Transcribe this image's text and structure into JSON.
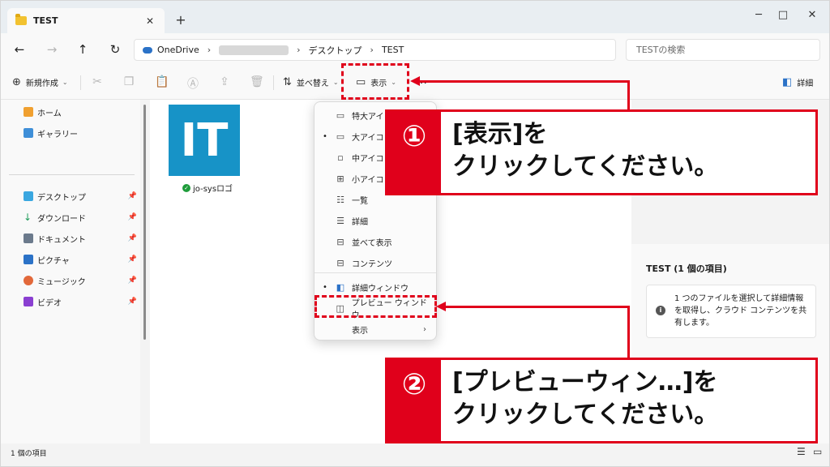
{
  "window": {
    "tab_title": "TEST",
    "tab_close": "✕",
    "tab_add": "+",
    "minimize": "─",
    "maximize": "□",
    "close": "✕"
  },
  "nav": {
    "back": "←",
    "forward": "→",
    "up": "↑",
    "refresh": "↻",
    "breadcrumb": [
      "OneDrive",
      "デスクトップ",
      "TEST"
    ],
    "crumb_sep": "›",
    "search_placeholder": "TESTの検索"
  },
  "toolbar": {
    "new_label": "新規作成",
    "sort_label": "並べ替え",
    "view_label": "表示",
    "more": "…",
    "details_label": "詳細"
  },
  "sidebar": {
    "home": "ホーム",
    "gallery": "ギャラリー",
    "pinned": [
      "デスクトップ",
      "ダウンロード",
      "ドキュメント",
      "ピクチャ",
      "ミュージック",
      "ビデオ"
    ],
    "pin_glyph": "📌"
  },
  "content": {
    "file_logo_text": "IT",
    "file_name": "jo-sysロゴ"
  },
  "details_pane": {
    "title": "TEST (1 個の項目)",
    "info_text": "1 つのファイルを選択して詳細情報を取得し、クラウド コンテンツを共有します。",
    "info_icon": "i"
  },
  "status": {
    "item_count": "1 個の項目"
  },
  "menu": {
    "items": [
      {
        "label": "特大アイコン",
        "bullet": ""
      },
      {
        "label": "大アイコン",
        "bullet": "•"
      },
      {
        "label": "中アイコン",
        "bullet": ""
      },
      {
        "label": "小アイコン",
        "bullet": ""
      },
      {
        "label": "一覧",
        "bullet": ""
      },
      {
        "label": "詳細",
        "bullet": ""
      },
      {
        "label": "並べて表示",
        "bullet": ""
      },
      {
        "label": "コンテンツ",
        "bullet": ""
      },
      {
        "label": "詳細ウィンドウ",
        "bullet": "•"
      },
      {
        "label": "プレビュー ウィンドウ",
        "bullet": ""
      },
      {
        "label": "表示",
        "bullet": ""
      }
    ],
    "submenu_chevron": "›"
  },
  "annotations": {
    "step1_num": "①",
    "step1_line1": "[表示]を",
    "step1_line2": "クリックしてください。",
    "step2_num": "②",
    "step2_line1": "[プレビューウィン…]を",
    "step2_line2": "クリックしてください。",
    "accent_color": "#e0001b"
  }
}
